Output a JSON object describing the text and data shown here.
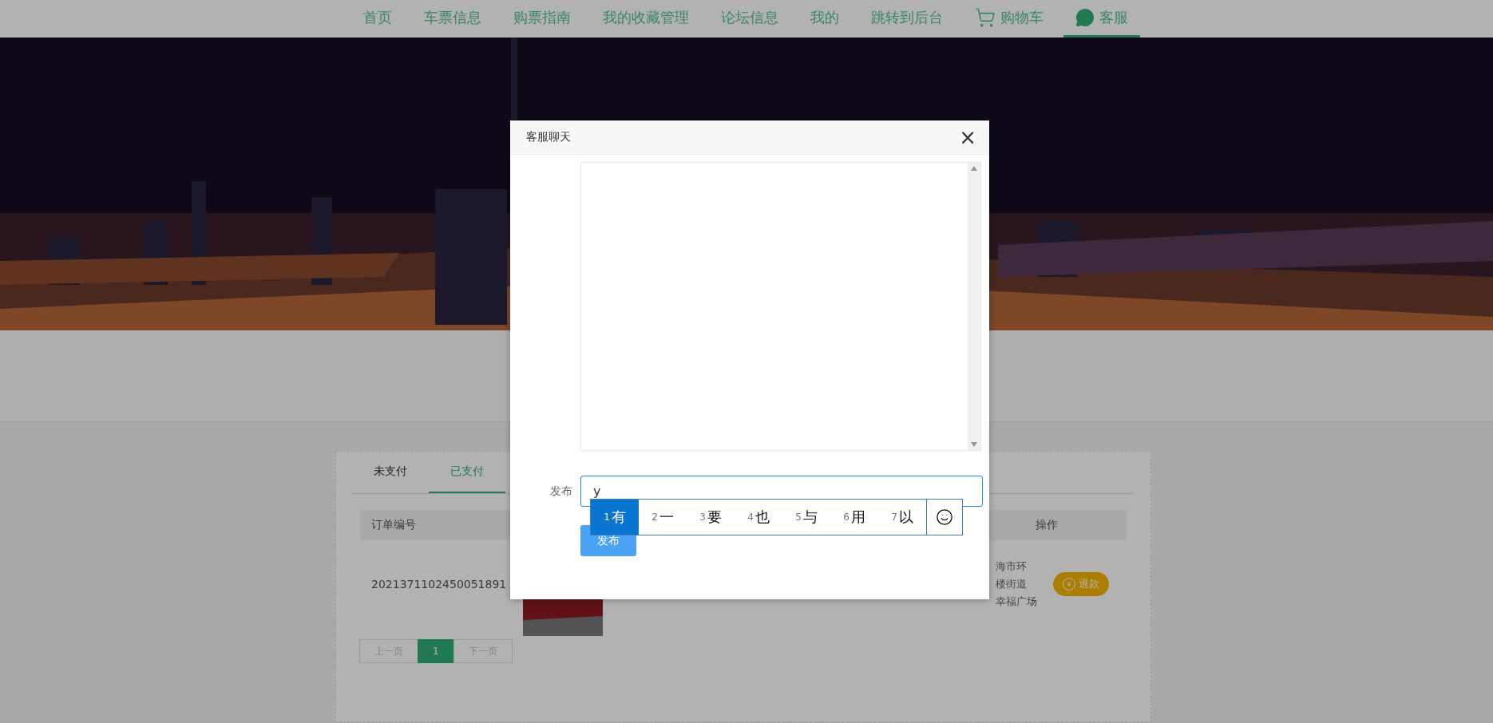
{
  "nav": {
    "items": [
      {
        "label": "首页",
        "kind": "plain",
        "selected": false
      },
      {
        "label": "车票信息",
        "kind": "plain",
        "selected": false
      },
      {
        "label": "购票指南",
        "kind": "plain",
        "selected": false
      },
      {
        "label": "我的收藏管理",
        "kind": "plain",
        "selected": false
      },
      {
        "label": "论坛信息",
        "kind": "plain",
        "selected": false
      },
      {
        "label": "我的",
        "kind": "plain",
        "selected": false
      },
      {
        "label": "跳转到后台",
        "kind": "plain",
        "selected": false
      },
      {
        "label": "购物车",
        "kind": "cart",
        "selected": false
      },
      {
        "label": "客服",
        "kind": "chat",
        "selected": true
      }
    ]
  },
  "orders": {
    "tabs": [
      {
        "label": "未支付",
        "selected": false
      },
      {
        "label": "已支付",
        "selected": true
      }
    ],
    "columns": [
      "订单编号",
      "操作"
    ],
    "rows": [
      {
        "order_no": "2021371102450051891",
        "address": [
          "海市环",
          "楼街道",
          "幸福广场"
        ],
        "action_icon": "¥",
        "action": "退款"
      }
    ],
    "pagination": [
      {
        "label": "上一页",
        "selected": false
      },
      {
        "label": "1",
        "selected": true
      },
      {
        "label": "下一页",
        "selected": false
      }
    ]
  },
  "dialog": {
    "title": "客服聊天",
    "close": "×",
    "label": "发布",
    "value": "y",
    "button": "发布"
  },
  "ime": {
    "candidates": [
      {
        "index": "1",
        "text": "有",
        "selected": true
      },
      {
        "index": "2",
        "text": "一",
        "selected": false
      },
      {
        "index": "3",
        "text": "要",
        "selected": false
      },
      {
        "index": "4",
        "text": "也",
        "selected": false
      },
      {
        "index": "5",
        "text": "与",
        "selected": false
      },
      {
        "index": "6",
        "text": "用",
        "selected": false
      },
      {
        "index": "7",
        "text": "以",
        "selected": false
      }
    ]
  }
}
